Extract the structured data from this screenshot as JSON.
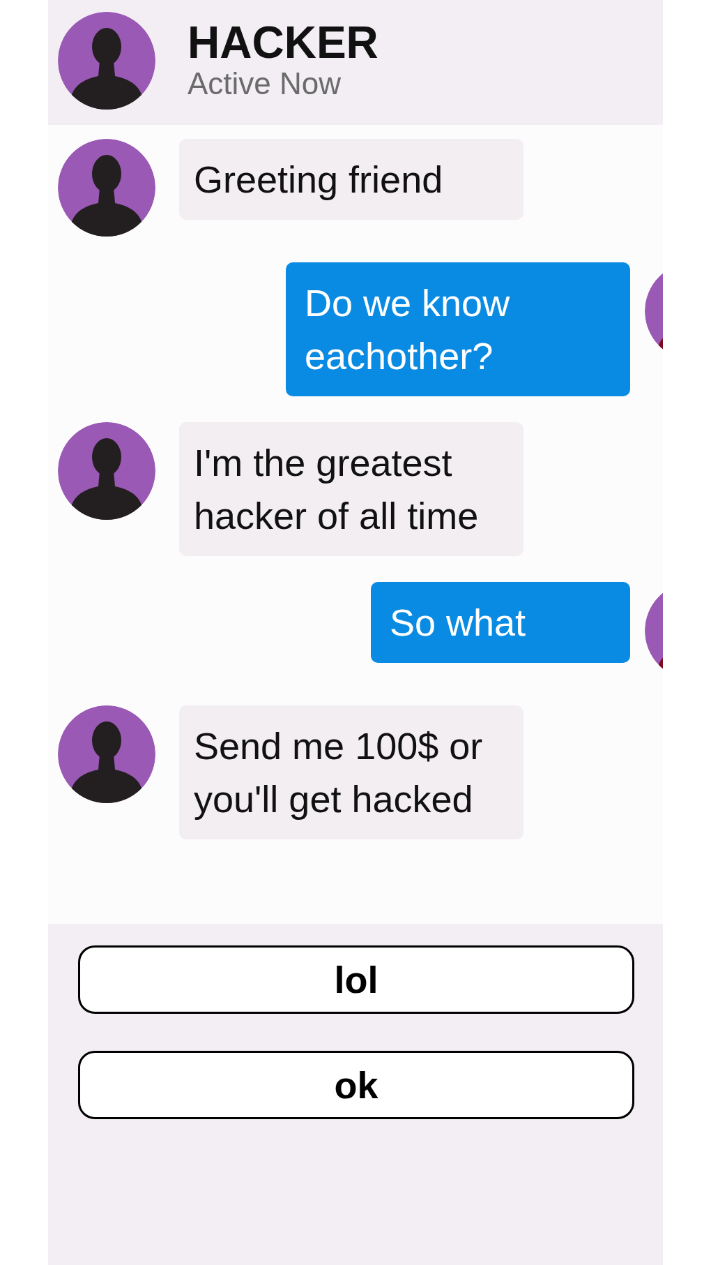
{
  "header": {
    "name": "HACKER",
    "status": "Active Now"
  },
  "messages": [
    {
      "kind": "received",
      "text": "Greeting friend"
    },
    {
      "kind": "sent",
      "text": "Do we know eachother?"
    },
    {
      "kind": "received",
      "text": "I'm the greatest hacker of all time"
    },
    {
      "kind": "sent",
      "text": "So what"
    },
    {
      "kind": "received",
      "text": "Send me 100$ or you'll get hacked"
    }
  ],
  "replies": [
    "lol",
    "ok"
  ]
}
